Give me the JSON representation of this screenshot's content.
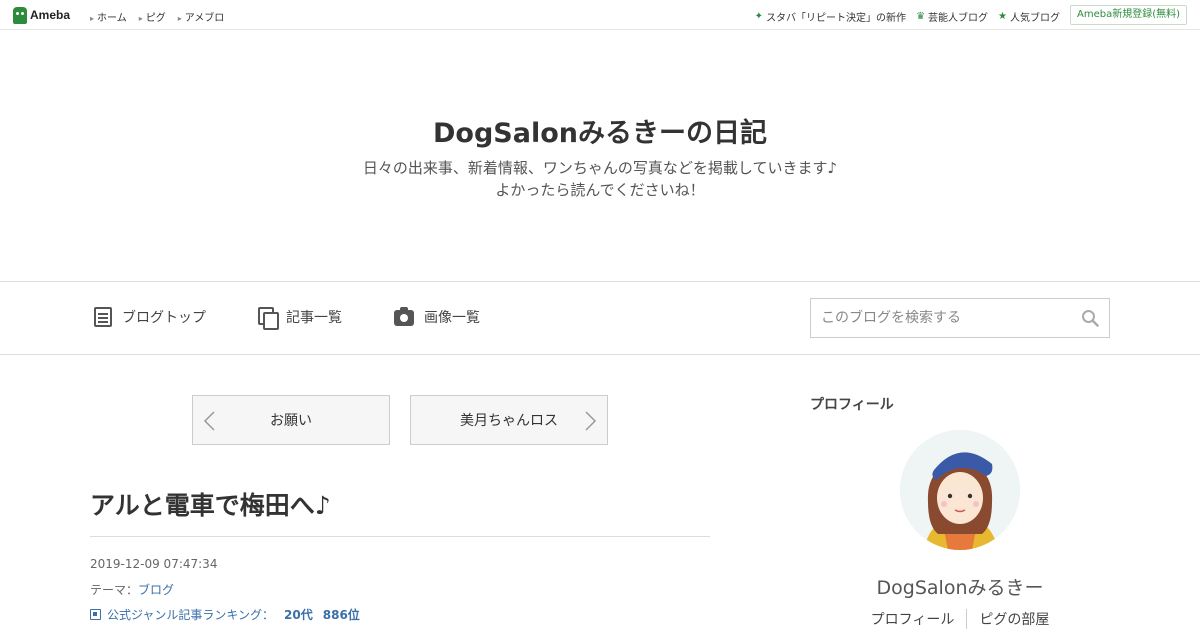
{
  "topbar": {
    "logo_text": "Ameba",
    "links": [
      "ホーム",
      "ピグ",
      "アメブロ"
    ],
    "right_links": [
      {
        "label": "スタバ「リピート決定」の新作",
        "icon": "sparkle-icon"
      },
      {
        "label": "芸能人ブログ",
        "icon": "crown-icon"
      },
      {
        "label": "人気ブログ",
        "icon": "star-icon"
      }
    ],
    "register_label": "Ameba新規登録(無料)"
  },
  "blog": {
    "title": "DogSalonみるきーの日記",
    "description_line1": "日々の出来事、新着情報、ワンちゃんの写真などを掲載していきます♪",
    "description_line2": "よかったら読んでくださいね！"
  },
  "nav": {
    "items": [
      {
        "label": "ブログトップ",
        "icon": "document-icon"
      },
      {
        "label": "記事一覧",
        "icon": "copy-icon"
      },
      {
        "label": "画像一覧",
        "icon": "camera-icon"
      }
    ],
    "search_placeholder": "このブログを検索する"
  },
  "pager": {
    "prev_label": "お願い",
    "next_label": "美月ちゃんロス"
  },
  "article": {
    "title": "アルと電車で梅田へ♪",
    "date": "2019-12-09 07:47:34",
    "theme_prefix": "テーマ：",
    "theme": "ブログ",
    "rank_label": "公式ジャンル記事ランキング：",
    "rank_genre": "20代",
    "rank_position": "886位"
  },
  "sidebar": {
    "heading": "プロフィール",
    "profile_name": "DogSalonみるきー",
    "links": [
      "プロフィール",
      "ピグの部屋"
    ]
  },
  "colors": {
    "accent_green": "#2d8c3c",
    "link_blue": "#3a6fa8"
  }
}
